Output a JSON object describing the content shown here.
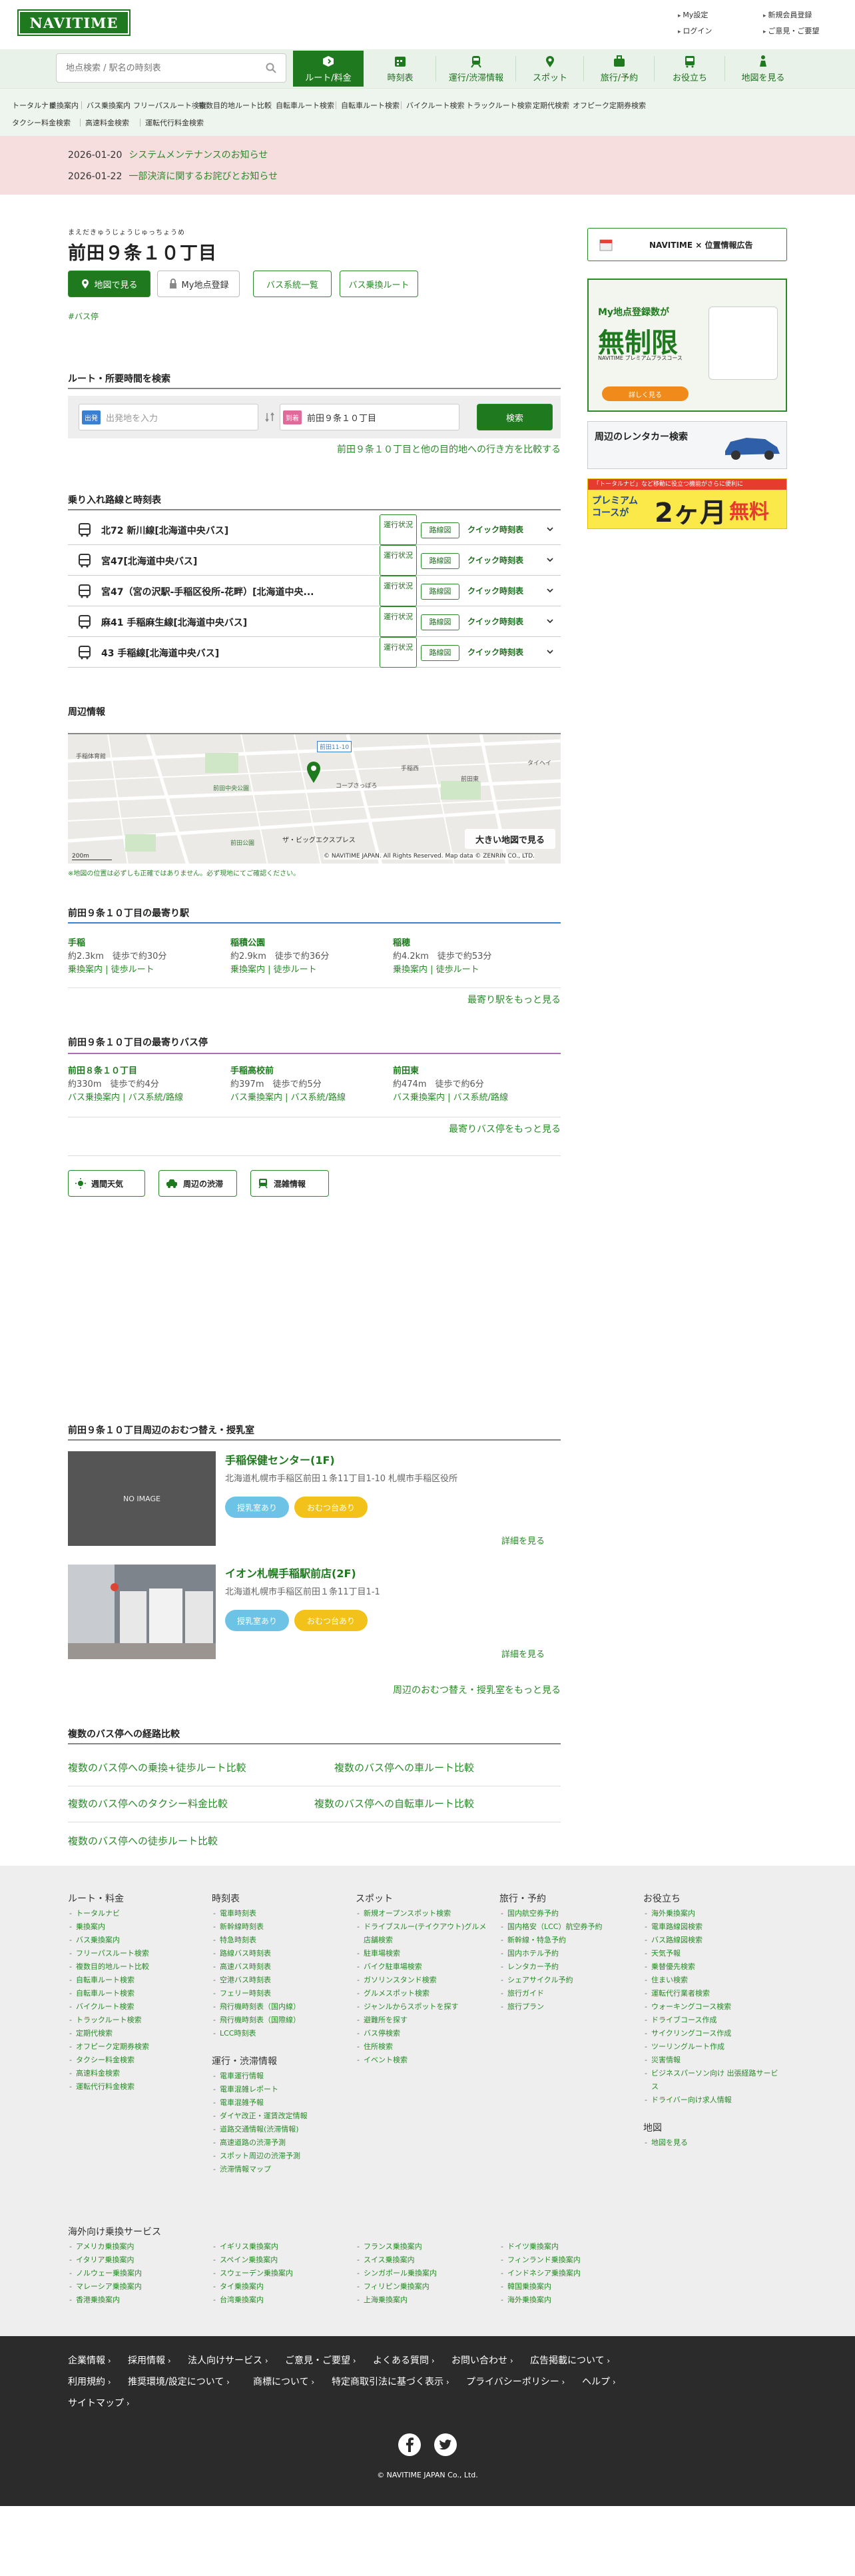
{
  "header": {
    "logo": "NAVITIME",
    "links": [
      "My設定",
      "新規会員登録",
      "ログイン",
      "ご意見・ご要望"
    ]
  },
  "search": {
    "placeholder": "地点検索 / 駅名の時刻表"
  },
  "nav": {
    "items": [
      "ルート/料金",
      "時刻表",
      "運行/渋滞情報",
      "スポット",
      "旅行/予約",
      "お役立ち",
      "地図を見る"
    ],
    "active": "ルート/料金"
  },
  "subnav": {
    "row1": [
      "トータルナビ",
      "乗換案内",
      "バス乗換案内",
      "フリーパスルート検索",
      "複数目的地ルート比較",
      "自転車ルート検索",
      "自転車ルート検索",
      "バイクルート検索",
      "トラックルート検索",
      "定期代検索",
      "オフピーク定期券検索"
    ],
    "row2": [
      "タクシー料金検索",
      "高速料金検索",
      "運転代行料金検索"
    ]
  },
  "notices": [
    {
      "date": "2026-01-20",
      "text": "システムメンテナンスのお知らせ"
    },
    {
      "date": "2026-01-22",
      "text": "一部決済に関するお詫びとお知らせ"
    }
  ],
  "page": {
    "ruby": "まえだきゅうじょうじゅっちょうめ",
    "title": "前田９条１０丁目",
    "hashtag": "#バス停"
  },
  "actions": {
    "map": "地図で見る",
    "myspot": "My地点登録",
    "bus_list": "バス系統一覧",
    "bus_route": "バス乗換ルート"
  },
  "route_search": {
    "title": "ルート・所要時間を検索",
    "from_tag": "出発",
    "from_placeholder": "出発地を入力",
    "to_tag": "到着",
    "to_value": "前田９条１０丁目",
    "button": "検索",
    "compare_link": "前田９条１０丁目と他の目的地への行き方を比較する"
  },
  "lines": {
    "title": "乗り入れ路線と時刻表",
    "items": [
      "北72 新川線[北海道中央バス]",
      "宮47[北海道中央バス]",
      "宮47（宮の沢駅-手稲区役所-花畔）[北海道中央...",
      "麻41 手稲麻生線[北海道中央バス]",
      "43 手稲線[北海道中央バス]"
    ],
    "ops_label": "運行状況",
    "route_label": "路線図",
    "quick_label": "クイック時刻表"
  },
  "nearby": {
    "title": "周辺情報",
    "map_labels": [
      "前田11-10",
      "手稲体育館",
      "前田中央公園",
      "コープさっぽろ",
      "手稲西",
      "前田東",
      "タイヘイ",
      "前田公園",
      "ザ・ビッグエクスプレス"
    ],
    "scale": "200m",
    "copyright": "© NAVITIME JAPAN. All Rights Reserved. Map data © ZENRIN CO., LTD.",
    "note": "※地図の位置は必ずしも正確ではありません。必ず現地にてご確認ください。",
    "large_map": "大きい地図で見る"
  },
  "stations": {
    "title": "前田９条１０丁目の最寄り駅",
    "items": [
      {
        "name": "手稲",
        "dist": "約2.3km　徒歩で約30分",
        "links": "乗換案内 | 徒歩ルート"
      },
      {
        "name": "稲積公園",
        "dist": "約2.9km　徒歩で約36分",
        "links": "乗換案内 | 徒歩ルート"
      },
      {
        "name": "稲穂",
        "dist": "約4.2km　徒歩で約53分",
        "links": "乗換案内 | 徒歩ルート"
      }
    ],
    "more": "最寄り駅をもっと見る"
  },
  "bus_stops": {
    "title": "前田９条１０丁目の最寄りバス停",
    "items": [
      {
        "name": "前田８条１０丁目",
        "dist": "約330m　徒歩で約4分",
        "links": "バス乗換案内 | バス系統/路線"
      },
      {
        "name": "手稲高校前",
        "dist": "約397m　徒歩で約5分",
        "links": "バス乗換案内 | バス系統/路線"
      },
      {
        "name": "前田東",
        "dist": "約474m　徒歩で約6分",
        "links": "バス乗換案内 | バス系統/路線"
      }
    ],
    "more": "最寄りバス停をもっと見る"
  },
  "info_buttons": [
    "週間天気",
    "周辺の渋滞",
    "混雑情報"
  ],
  "nursing": {
    "title": "前田９条１０丁目周辺のおむつ替え・授乳室",
    "noimage": "NO IMAGE",
    "tags": [
      "授乳室あり",
      "おむつ台あり"
    ],
    "detail": "詳細を見る",
    "items": [
      {
        "name": "手稲保健センター(1F)",
        "addr": "北海道札幌市手稲区前田１条11丁目1-10 札幌市手稲区役所"
      },
      {
        "name": "イオン札幌手稲駅前店(2F)",
        "addr": "北海道札幌市手稲区前田１条11丁目1-1"
      }
    ],
    "more": "周辺のおむつ替え・授乳室をもっと見る"
  },
  "compare": {
    "title": "複数のバス停への経路比較",
    "links": [
      "複数のバス停への乗換+徒歩ルート比較",
      "複数のバス停への車ルート比較",
      "複数のバス停へのタクシー料金比較",
      "複数のバス停への自転車ルート比較",
      "複数のバス停への徒歩ルート比較"
    ]
  },
  "ads": {
    "banner": "NAVITIME × 位置情報広告",
    "ad2_head": "My地点登録数が",
    "ad2_big": "無制限",
    "ad2_sub": "NAVITIME プレミアムプラスコース",
    "ad2_btn": "詳しく見る",
    "ad3": "周辺のレンタカー検索",
    "ad4_a": "「トータルナビ」など移動に役立つ機能がさらに便利に",
    "ad4_b": "プレミアム\nコースが",
    "ad4_c": "2ヶ月",
    "ad4_d": "無料"
  },
  "footer": {
    "route": {
      "head": "ルート・料金",
      "items": [
        "トータルナビ",
        "乗換案内",
        "バス乗換案内",
        "フリーパスルート検索",
        "複数目的地ルート比較",
        "自転車ルート検索",
        "自転車ルート検索",
        "バイクルート検索",
        "トラックルート検索",
        "定期代検索",
        "オフピーク定期券検索",
        "タクシー料金検索",
        "高速料金検索",
        "運転代行料金検索"
      ]
    },
    "timetable": {
      "head": "時刻表",
      "items": [
        "電車時刻表",
        "新幹線時刻表",
        "特急時刻表",
        "路線バス時刻表",
        "高速バス時刻表",
        "空港バス時刻表",
        "フェリー時刻表",
        "飛行機時刻表（国内線）",
        "飛行機時刻表（国際線）",
        "LCC時刻表"
      ]
    },
    "traffic": {
      "head": "運行・渋滞情報",
      "items": [
        "電車運行情報",
        "電車混雑レポート",
        "電車混雑予報",
        "ダイヤ改正・運賃改定情報",
        "道路交通情報(渋滞情報)",
        "高速道路の渋滞予測",
        "スポット周辺の渋滞予測",
        "渋滞情報マップ"
      ]
    },
    "spot": {
      "head": "スポット",
      "items": [
        "新規オープンスポット検索",
        "ドライブスルー(テイクアウト)グルメ店舗検索",
        "駐車場検索",
        "バイク駐車場検索",
        "ガソリンスタンド検索",
        "グルメスポット検索",
        "ジャンルからスポットを探す",
        "避難所を探す",
        "バス停検索",
        "住所検索",
        "イベント検索"
      ]
    },
    "travel": {
      "head": "旅行・予約",
      "items": [
        "国内航空券予約",
        "国内格安（LCC）航空券予約",
        "新幹線・特急予約",
        "国内ホテル予約",
        "レンタカー予約",
        "シェアサイクル予約",
        "旅行ガイド",
        "旅行プラン"
      ]
    },
    "useful": {
      "head": "お役立ち",
      "items": [
        "海外乗換案内",
        "電車路線図検索",
        "バス路線図検索",
        "天気予報",
        "乗替優先検索",
        "住まい検索",
        "運転代行業者検索",
        "ウォーキングコース検索",
        "ドライブコース作成",
        "サイクリングコース作成",
        "ツーリングルート作成",
        "災害情報",
        "ビジネスパーソン向け 出張経路サービス",
        "ドライバー向け求人情報"
      ]
    },
    "map": {
      "head": "地図",
      "items": [
        "地図を見る"
      ]
    },
    "overseas": {
      "head": "海外向け乗換サービス",
      "c1": [
        "アメリカ乗換案内",
        "イタリア乗換案内",
        "ノルウェー乗換案内",
        "マレーシア乗換案内",
        "香港乗換案内"
      ],
      "c2": [
        "イギリス乗換案内",
        "スペイン乗換案内",
        "スウェーデン乗換案内",
        "タイ乗換案内",
        "台湾乗換案内"
      ],
      "c3": [
        "フランス乗換案内",
        "スイス乗換案内",
        "シンガポール乗換案内",
        "フィリピン乗換案内",
        "上海乗換案内"
      ],
      "c4": [
        "ドイツ乗換案内",
        "フィンランド乗換案内",
        "インドネシア乗換案内",
        "韓国乗換案内",
        "海外乗換案内"
      ]
    }
  },
  "bottom": {
    "links": [
      "企業情報",
      "採用情報",
      "法人向けサービス",
      "ご意見・ご要望",
      "よくある質問",
      "お問い合わせ",
      "広告掲載について",
      "利用規約",
      "推奨環境/設定について",
      "商標について",
      "特定商取引法に基づく表示",
      "プライバシーポリシー",
      "ヘルプ",
      "サイトマップ"
    ],
    "copyright": "© NAVITIME JAPAN Co., Ltd."
  },
  "colors": {
    "brand": "#1f7a1f",
    "link": "#2a8a2a",
    "notice_bg": "#f7dede",
    "footer_bg": "#eeeeee",
    "bottom_bg": "#2b2b2b",
    "tag_blue": "#6cc3e6",
    "tag_yellow": "#f2c21a"
  }
}
